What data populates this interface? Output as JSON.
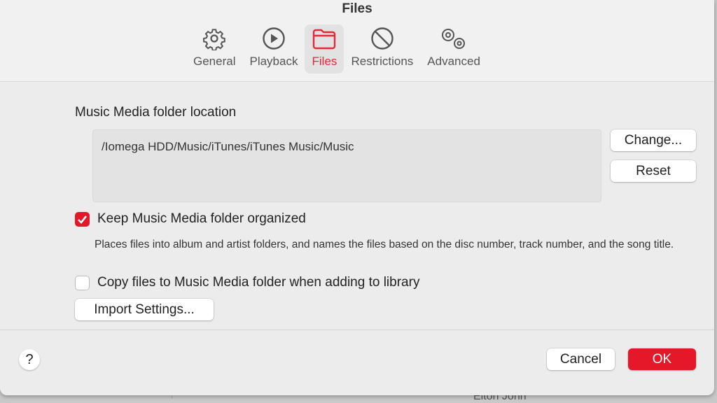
{
  "window": {
    "title": "Files"
  },
  "tabs": [
    {
      "label": "General",
      "icon": "gear-icon"
    },
    {
      "label": "Playback",
      "icon": "play-circle-icon"
    },
    {
      "label": "Files",
      "icon": "folder-icon",
      "active": true
    },
    {
      "label": "Restrictions",
      "icon": "prohibited-icon"
    },
    {
      "label": "Advanced",
      "icon": "gears-icon"
    }
  ],
  "main": {
    "folder_label": "Music Media folder location",
    "folder_path": "/Iomega HDD/Music/iTunes/iTunes Music/Music",
    "change_label": "Change...",
    "reset_label": "Reset",
    "keep_organized": {
      "label": "Keep Music Media folder organized",
      "checked": true
    },
    "keep_desc": "Places files into album and artist folders, and names the files based on the disc number, track number, and the song title.",
    "copy_files": {
      "label": "Copy files to Music Media folder when adding to library",
      "checked": false
    },
    "import_label": "Import Settings..."
  },
  "footer": {
    "help": "?",
    "cancel": "Cancel",
    "ok": "OK"
  },
  "background": {
    "text": "Elton John"
  },
  "colors": {
    "accent": "#e5182a"
  }
}
